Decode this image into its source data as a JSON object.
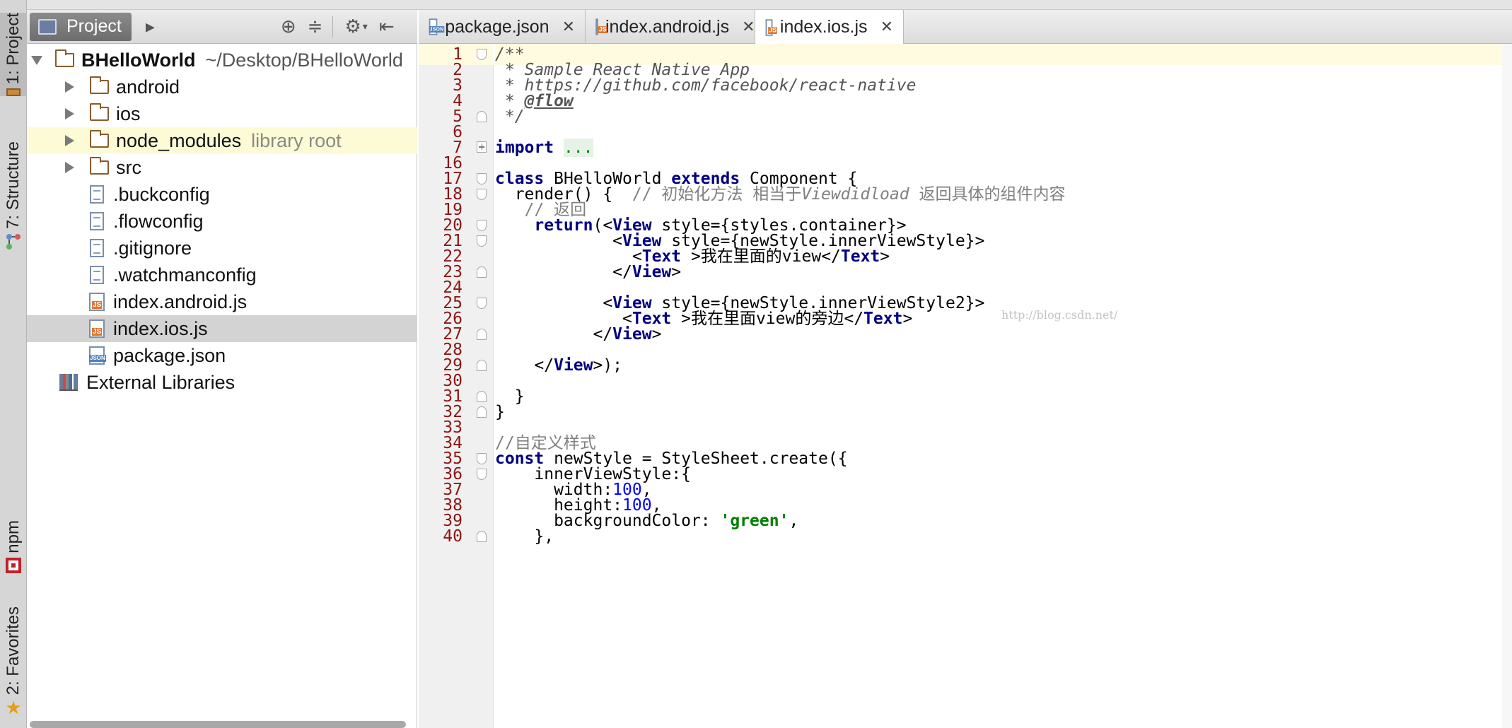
{
  "tool_strip": {
    "project_tab": "1: Project",
    "structure_tab": "7: Structure",
    "npm_tab": "npm",
    "favorites_tab": "2: Favorites"
  },
  "project_panel": {
    "title": "Project",
    "tree": [
      {
        "name": "BHelloWorld",
        "sub": "~/Desktop/BHelloWorld",
        "icon": "folder-icon",
        "level": 0,
        "expanded": true
      },
      {
        "name": "android",
        "icon": "folder-icon",
        "level": 1,
        "expandable": true
      },
      {
        "name": "ios",
        "icon": "folder-icon",
        "level": 1,
        "expandable": true
      },
      {
        "name": "node_modules",
        "sub": "library root",
        "icon": "folder-icon",
        "level": 1,
        "expandable": true,
        "highlight": true
      },
      {
        "name": "src",
        "icon": "folder-icon",
        "level": 1,
        "expandable": true
      },
      {
        "name": ".buckconfig",
        "icon": "text-file-icon",
        "level": 1
      },
      {
        "name": ".flowconfig",
        "icon": "text-file-icon",
        "level": 1
      },
      {
        "name": ".gitignore",
        "icon": "text-file-icon",
        "level": 1
      },
      {
        "name": ".watchmanconfig",
        "icon": "text-file-icon",
        "level": 1
      },
      {
        "name": "index.android.js",
        "icon": "js-file-icon",
        "level": 1
      },
      {
        "name": "index.ios.js",
        "icon": "js-file-icon",
        "level": 1,
        "selected": true
      },
      {
        "name": "package.json",
        "icon": "json-file-icon",
        "level": 1
      },
      {
        "name": "External Libraries",
        "icon": "library-icon",
        "level": 0
      }
    ]
  },
  "editor": {
    "tabs": [
      {
        "label": "package.json",
        "icon": "json-file-icon"
      },
      {
        "label": "index.android.js",
        "icon": "js-file-icon"
      },
      {
        "label": "index.ios.js",
        "icon": "js-file-icon",
        "active": true
      }
    ],
    "line_numbers": [
      "1",
      "2",
      "3",
      "4",
      "5",
      "6",
      "7",
      "16",
      "17",
      "18",
      "19",
      "20",
      "21",
      "22",
      "23",
      "24",
      "25",
      "26",
      "27",
      "28",
      "29",
      "30",
      "31",
      "32",
      "33",
      "34",
      "35",
      "36",
      "37",
      "38",
      "39",
      "40"
    ],
    "code": {
      "l1": "/**",
      "l2": " * Sample React Native App",
      "l3": " * https://github.com/facebook/react-native",
      "l4a": " * ",
      "l4b": "@flow",
      "l5": " */",
      "l7_kw": "import",
      "l7_fold": "...",
      "l17_kw1": "class",
      "l17_name": " BHelloWorld ",
      "l17_kw2": "extends",
      "l17_rest": " Component {",
      "l18_code": "  render() {  ",
      "l18_cm1": "// 初始化方法 相当于",
      "l18_cm2": "Viewdidload",
      "l18_cm3": " 返回具体的组件内容",
      "l19_cm": "   // 返回",
      "l20_pre": "    ",
      "l20_kw": "return",
      "l20_a": "(<",
      "l20_tag": "View",
      "l20_b": " style={styles.container}>",
      "l21_pre": "            <",
      "l21_tag": "View",
      "l21_b": " style={newStyle.innerViewStyle}>",
      "l22_pre": "              <",
      "l22_tag": "Text",
      "l22_b": " >我在里面的view</",
      "l22_tag2": "Text",
      "l22_c": ">",
      "l23_pre": "            </",
      "l23_tag": "View",
      "l23_b": ">",
      "l25_pre": "           <",
      "l25_tag": "View",
      "l25_b": " style={newStyle.innerViewStyle2}>",
      "l26_pre": "             <",
      "l26_tag": "Text",
      "l26_b": " >我在里面view的旁边</",
      "l26_tag2": "Text",
      "l26_c": ">",
      "l27_pre": "          </",
      "l27_tag": "View",
      "l27_b": ">",
      "l29_pre": "    </",
      "l29_tag": "View",
      "l29_b": ">);",
      "l31": "  }",
      "l32": "}",
      "l34_cm": "//自定义样式",
      "l35_kw": "const",
      "l35_rest": " newStyle = StyleSheet.create({",
      "l36": "    innerViewStyle:{",
      "l37_a": "      width:",
      "l37_num": "100",
      "l37_b": ",",
      "l38_a": "      height:",
      "l38_num": "100",
      "l38_b": ",",
      "l39_a": "      backgroundColor: ",
      "l39_str": "'green'",
      "l39_b": ",",
      "l40": "    },"
    },
    "watermark": "http://blog.csdn.net/"
  }
}
